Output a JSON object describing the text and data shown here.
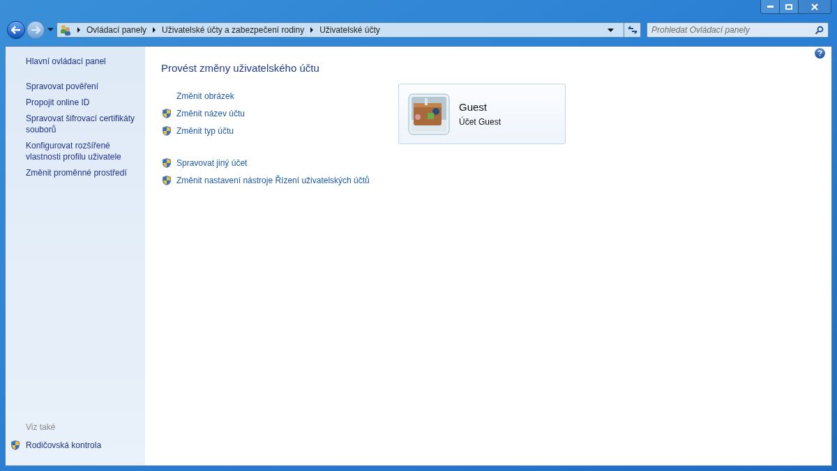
{
  "address_bar": {
    "breadcrumbs": [
      "Ovládací panely",
      "Uživatelské účty a zabezpečení rodiny",
      "Uživatelské účty"
    ]
  },
  "search": {
    "placeholder": "Prohledat Ovládací panely"
  },
  "sidebar": {
    "items": [
      {
        "label": "Hlavní ovládací panel"
      },
      {
        "label": "Spravovat pověření"
      },
      {
        "label": "Propojit online ID"
      },
      {
        "label": "Spravovat šifrovací certifikáty souborů"
      },
      {
        "label": "Konfigurovat rozšířené vlastnosti profilu uživatele"
      },
      {
        "label": "Změnit proměnné prostředí"
      }
    ],
    "see_also": {
      "heading": "Viz také",
      "items": [
        {
          "label": "Rodičovská kontrola",
          "shield": true
        }
      ]
    }
  },
  "main": {
    "title": "Provést změny uživatelského účtu",
    "task_groups": [
      [
        {
          "label": "Změnit obrázek",
          "shield": false
        },
        {
          "label": "Změnit název účtu",
          "shield": true
        },
        {
          "label": "Změnit typ účtu",
          "shield": true
        }
      ],
      [
        {
          "label": "Spravovat jiný účet",
          "shield": true
        },
        {
          "label": "Změnit nastavení nástroje Řízení uživatelských účtů",
          "shield": true
        }
      ]
    ],
    "account": {
      "name": "Guest",
      "type": "Účet Guest"
    }
  }
}
